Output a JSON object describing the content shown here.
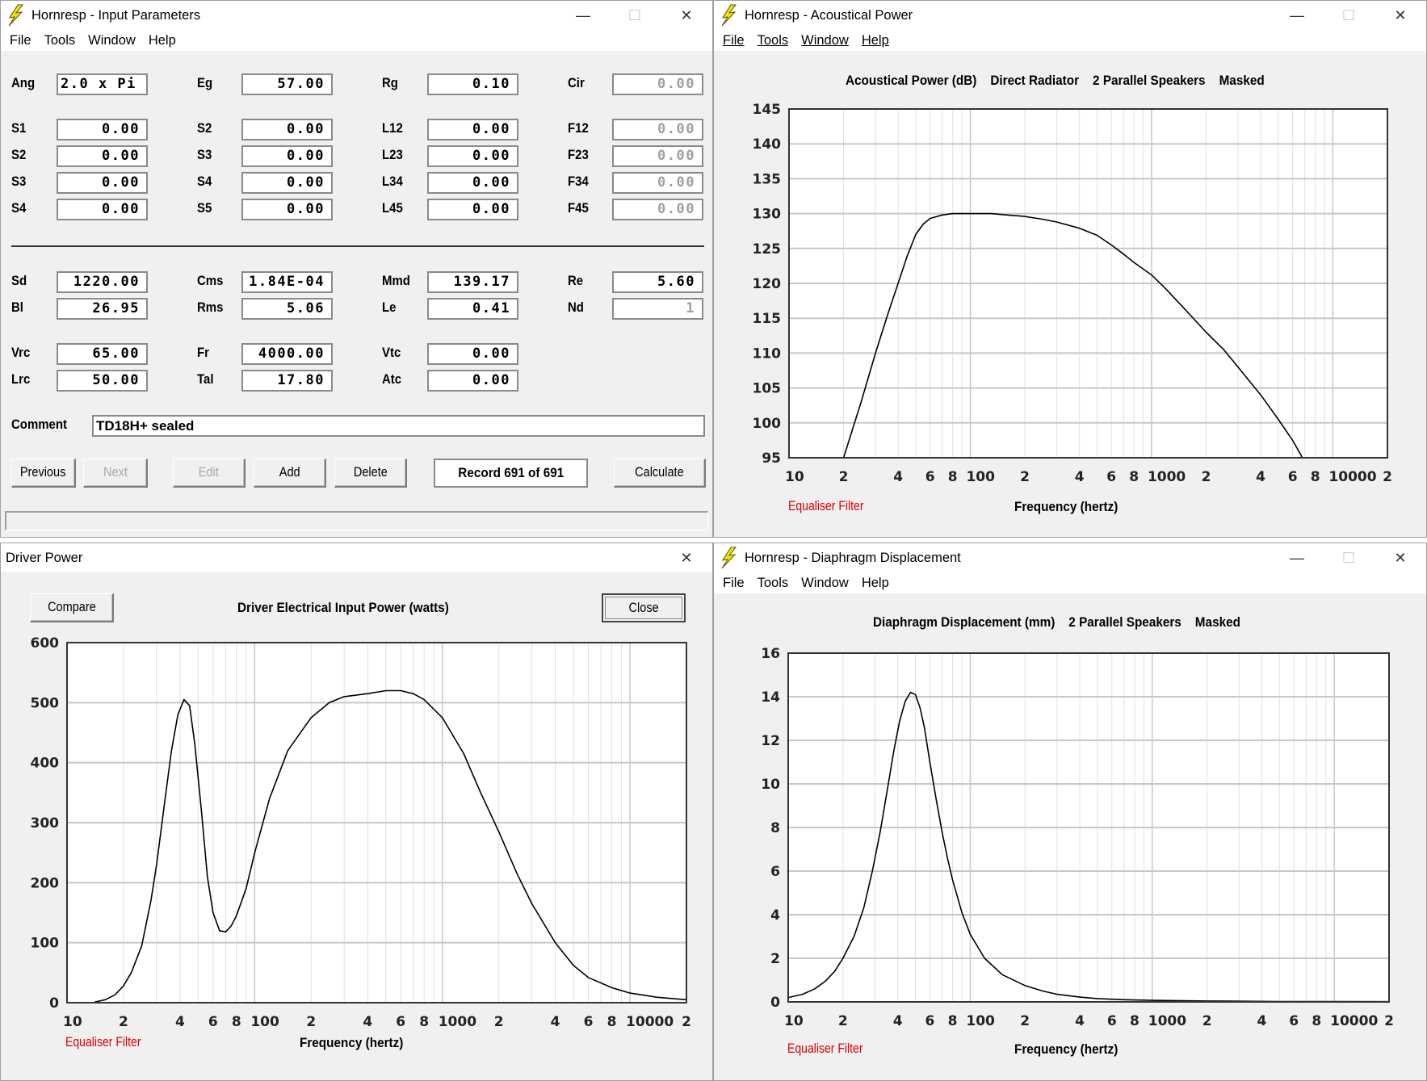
{
  "colors": {
    "window_bg": "#f0f0f0",
    "titlebar_bg": "#ffffff",
    "plot_bg": "#ffffff",
    "grid_major": "#c8c8c8",
    "grid_minor": "#e0e0e0",
    "curve": "#000000",
    "equaliser_filter": "#e00000",
    "app_icon": "#f2e600"
  },
  "menus": {
    "file": "File",
    "tools": "Tools",
    "window": "Window",
    "help": "Help"
  },
  "window_controls": {
    "minimize": "—",
    "maximize": "☐",
    "close": "✕"
  },
  "input_parameters": {
    "title": "Hornresp - Input Parameters",
    "rows": [
      [
        {
          "label": "Ang",
          "value": "2.0 x Pi",
          "align": "left",
          "disabled": false
        },
        {
          "label": "Eg",
          "value": "57.00",
          "disabled": false
        },
        {
          "label": "Rg",
          "value": "0.10",
          "disabled": false
        },
        {
          "label": "Cir",
          "value": "0.00",
          "disabled": true
        }
      ],
      [
        {
          "label": "S1",
          "value": "0.00",
          "disabled": false
        },
        {
          "label": "S2",
          "value": "0.00",
          "disabled": false
        },
        {
          "label": "L12",
          "value": "0.00",
          "disabled": false
        },
        {
          "label": "F12",
          "value": "0.00",
          "disabled": true
        }
      ],
      [
        {
          "label": "S2",
          "value": "0.00",
          "disabled": false
        },
        {
          "label": "S3",
          "value": "0.00",
          "disabled": false
        },
        {
          "label": "L23",
          "value": "0.00",
          "disabled": false
        },
        {
          "label": "F23",
          "value": "0.00",
          "disabled": true
        }
      ],
      [
        {
          "label": "S3",
          "value": "0.00",
          "disabled": false
        },
        {
          "label": "S4",
          "value": "0.00",
          "disabled": false
        },
        {
          "label": "L34",
          "value": "0.00",
          "disabled": false
        },
        {
          "label": "F34",
          "value": "0.00",
          "disabled": true
        }
      ],
      [
        {
          "label": "S4",
          "value": "0.00",
          "disabled": false
        },
        {
          "label": "S5",
          "value": "0.00",
          "disabled": false
        },
        {
          "label": "L45",
          "value": "0.00",
          "disabled": false
        },
        {
          "label": "F45",
          "value": "0.00",
          "disabled": true
        }
      ],
      [
        {
          "label": "Sd",
          "value": "1220.00",
          "disabled": false
        },
        {
          "label": "Cms",
          "value": "1.84E-04",
          "disabled": false
        },
        {
          "label": "Mmd",
          "value": "139.17",
          "disabled": false
        },
        {
          "label": "Re",
          "value": "5.60",
          "disabled": false
        }
      ],
      [
        {
          "label": "Bl",
          "value": "26.95",
          "disabled": false
        },
        {
          "label": "Rms",
          "value": "5.06",
          "disabled": false
        },
        {
          "label": "Le",
          "value": "0.41",
          "disabled": false
        },
        {
          "label": "Nd",
          "value": "1",
          "disabled": true
        }
      ],
      [
        {
          "label": "Vrc",
          "value": "65.00",
          "disabled": false
        },
        {
          "label": "Fr",
          "value": "4000.00",
          "disabled": false
        },
        {
          "label": "Vtc",
          "value": "0.00",
          "disabled": false
        }
      ],
      [
        {
          "label": "Lrc",
          "value": "50.00",
          "disabled": false
        },
        {
          "label": "Tal",
          "value": "17.80",
          "disabled": false
        },
        {
          "label": "Atc",
          "value": "0.00",
          "disabled": false
        }
      ]
    ],
    "comment_label": "Comment",
    "comment_value": "TD18H+ sealed",
    "buttons": {
      "previous": {
        "label": "Previous",
        "disabled": false
      },
      "next": {
        "label": "Next",
        "disabled": true
      },
      "edit": {
        "label": "Edit",
        "disabled": true
      },
      "add": {
        "label": "Add",
        "disabled": false
      },
      "delete": {
        "label": "Delete",
        "disabled": false
      },
      "calculate": {
        "label": "Calculate",
        "disabled": false
      }
    },
    "record_status": "Record 691 of 691",
    "status_bar": ""
  },
  "acoustical_power": {
    "title": "Hornresp - Acoustical Power",
    "chart_title": "Acoustical Power (dB)    Direct Radiator    2 Parallel Speakers    Masked",
    "equaliser_filter": "Equaliser Filter",
    "xlabel": "Frequency (hertz)"
  },
  "driver_power": {
    "title": "Driver Power",
    "compare_label": "Compare",
    "close_label": "Close",
    "chart_title": "Driver Electrical Input Power (watts)",
    "equaliser_filter": "Equaliser Filter",
    "xlabel": "Frequency (hertz)"
  },
  "diaphragm_displacement": {
    "title": "Hornresp - Diaphragm Displacement",
    "chart_title": "Diaphragm Displacement (mm)    2 Parallel Speakers    Masked",
    "equaliser_filter": "Equaliser Filter",
    "xlabel": "Frequency (hertz)"
  },
  "chart_data": [
    {
      "id": "acoustical_power",
      "type": "line",
      "title": "Acoustical Power (dB)  Direct Radiator  2 Parallel Speakers  Masked",
      "xlabel": "Frequency (hertz)",
      "ylabel": "",
      "xscale": "log",
      "xlim": [
        10,
        20000
      ],
      "ylim": [
        95,
        145
      ],
      "yticks": [
        95,
        100,
        105,
        110,
        115,
        120,
        125,
        130,
        135,
        140,
        145
      ],
      "xtick_labels": [
        {
          "f": 10,
          "t": "10"
        },
        {
          "f": 20,
          "t": "2"
        },
        {
          "f": 40,
          "t": "4"
        },
        {
          "f": 60,
          "t": "6"
        },
        {
          "f": 80,
          "t": "8"
        },
        {
          "f": 100,
          "t": "100"
        },
        {
          "f": 200,
          "t": "2"
        },
        {
          "f": 400,
          "t": "4"
        },
        {
          "f": 600,
          "t": "6"
        },
        {
          "f": 800,
          "t": "8"
        },
        {
          "f": 1000,
          "t": "1000"
        },
        {
          "f": 2000,
          "t": "2"
        },
        {
          "f": 4000,
          "t": "4"
        },
        {
          "f": 6000,
          "t": "6"
        },
        {
          "f": 8000,
          "t": "8"
        },
        {
          "f": 10000,
          "t": "10000"
        },
        {
          "f": 20000,
          "t": "2"
        }
      ],
      "grid": true,
      "series": [
        {
          "name": "Acoustical Power",
          "x": [
            20,
            25,
            30,
            35,
            40,
            45,
            50,
            55,
            60,
            70,
            80,
            100,
            130,
            160,
            200,
            250,
            300,
            400,
            500,
            600,
            700,
            800,
            1000,
            1200,
            1500,
            2000,
            2500,
            3000,
            4000,
            5000,
            6000,
            6800
          ],
          "y": [
            95,
            103,
            110,
            115.5,
            120,
            124,
            127,
            128.5,
            129.3,
            129.8,
            130,
            130,
            130,
            129.8,
            129.6,
            129.2,
            128.8,
            127.9,
            126.9,
            125.5,
            124.2,
            123,
            121.2,
            119.2,
            116.5,
            113,
            110.5,
            108,
            104,
            100.5,
            97.5,
            95
          ]
        }
      ]
    },
    {
      "id": "driver_power",
      "type": "line",
      "title": "Driver Electrical Input Power (watts)",
      "xlabel": "Frequency (hertz)",
      "ylabel": "",
      "xscale": "log",
      "xlim": [
        10,
        20000
      ],
      "ylim": [
        0,
        600
      ],
      "yticks": [
        0,
        100,
        200,
        300,
        400,
        500,
        600
      ],
      "xtick_labels": [
        {
          "f": 10,
          "t": "10"
        },
        {
          "f": 20,
          "t": "2"
        },
        {
          "f": 40,
          "t": "4"
        },
        {
          "f": 60,
          "t": "6"
        },
        {
          "f": 80,
          "t": "8"
        },
        {
          "f": 100,
          "t": "100"
        },
        {
          "f": 200,
          "t": "2"
        },
        {
          "f": 400,
          "t": "4"
        },
        {
          "f": 600,
          "t": "6"
        },
        {
          "f": 800,
          "t": "8"
        },
        {
          "f": 1000,
          "t": "1000"
        },
        {
          "f": 2000,
          "t": "2"
        },
        {
          "f": 4000,
          "t": "4"
        },
        {
          "f": 6000,
          "t": "6"
        },
        {
          "f": 8000,
          "t": "8"
        },
        {
          "f": 10000,
          "t": "10000"
        },
        {
          "f": 20000,
          "t": "2"
        }
      ],
      "grid": true,
      "series": [
        {
          "name": "Input Power",
          "x": [
            14,
            16,
            18,
            20,
            22,
            25,
            28,
            30,
            33,
            36,
            39,
            42,
            45,
            48,
            52,
            56,
            60,
            65,
            70,
            75,
            80,
            90,
            100,
            120,
            150,
            200,
            250,
            300,
            400,
            500,
            600,
            700,
            800,
            1000,
            1300,
            1600,
            2000,
            2500,
            3000,
            4000,
            5000,
            6000,
            8000,
            10000,
            14000,
            20000
          ],
          "y": [
            1,
            5,
            13,
            28,
            50,
            95,
            170,
            230,
            330,
            420,
            480,
            505,
            495,
            430,
            320,
            210,
            150,
            120,
            118,
            128,
            145,
            190,
            250,
            340,
            420,
            475,
            500,
            510,
            515,
            520,
            520,
            515,
            505,
            475,
            415,
            350,
            285,
            215,
            165,
            100,
            62,
            42,
            25,
            16,
            9,
            5
          ]
        }
      ]
    },
    {
      "id": "diaphragm_displacement",
      "type": "line",
      "title": "Diaphragm Displacement (mm)  2 Parallel Speakers  Masked",
      "xlabel": "Frequency (hertz)",
      "ylabel": "",
      "xscale": "log",
      "xlim": [
        10,
        20000
      ],
      "ylim": [
        0,
        16
      ],
      "yticks": [
        0,
        2,
        4,
        6,
        8,
        10,
        12,
        14,
        16
      ],
      "xtick_labels": [
        {
          "f": 10,
          "t": "10"
        },
        {
          "f": 20,
          "t": "2"
        },
        {
          "f": 40,
          "t": "4"
        },
        {
          "f": 60,
          "t": "6"
        },
        {
          "f": 80,
          "t": "8"
        },
        {
          "f": 100,
          "t": "100"
        },
        {
          "f": 200,
          "t": "2"
        },
        {
          "f": 400,
          "t": "4"
        },
        {
          "f": 600,
          "t": "6"
        },
        {
          "f": 800,
          "t": "8"
        },
        {
          "f": 1000,
          "t": "1000"
        },
        {
          "f": 2000,
          "t": "2"
        },
        {
          "f": 4000,
          "t": "4"
        },
        {
          "f": 6000,
          "t": "6"
        },
        {
          "f": 8000,
          "t": "8"
        },
        {
          "f": 10000,
          "t": "10000"
        },
        {
          "f": 20000,
          "t": "2"
        }
      ],
      "grid": true,
      "series": [
        {
          "name": "Displacement",
          "x": [
            10,
            12,
            14,
            16,
            18,
            20,
            23,
            26,
            29,
            32,
            35,
            38,
            41,
            44,
            47,
            50,
            53,
            56,
            60,
            65,
            70,
            75,
            80,
            90,
            100,
            120,
            150,
            200,
            250,
            300,
            400,
            500,
            700,
            1000,
            2000,
            5000,
            20000
          ],
          "y": [
            0.2,
            0.35,
            0.6,
            0.95,
            1.4,
            2.0,
            3.0,
            4.3,
            6.0,
            7.8,
            9.7,
            11.5,
            12.9,
            13.8,
            14.2,
            14.1,
            13.5,
            12.6,
            11.0,
            9.3,
            7.8,
            6.6,
            5.6,
            4.1,
            3.1,
            2.0,
            1.25,
            0.75,
            0.5,
            0.35,
            0.22,
            0.15,
            0.1,
            0.07,
            0.04,
            0.02,
            0.01
          ]
        }
      ]
    }
  ]
}
